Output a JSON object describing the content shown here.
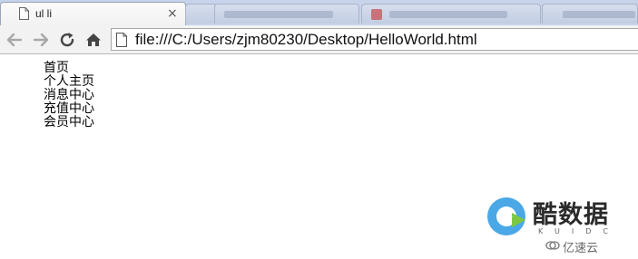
{
  "browser": {
    "active_tab": {
      "title": "ul li",
      "close_glyph": "×",
      "icon": "page-icon"
    },
    "toolbar": {
      "back_icon": "back-arrow-icon",
      "forward_icon": "forward-arrow-icon",
      "reload_icon": "reload-icon",
      "home_icon": "home-icon"
    },
    "address": {
      "url": "file:///C:/Users/zjm80230/Desktop/HelloWorld.html",
      "icon": "page-icon"
    }
  },
  "page": {
    "list_items": [
      "首页",
      "个人主页",
      "消息中心",
      "充值中心",
      "会员中心"
    ]
  },
  "watermark": {
    "brand": "酷数据",
    "sub": "KUIDC",
    "secondary": "亿速云"
  },
  "colors": {
    "tabstrip": "#c7d3ea",
    "toolbar": "#f2f2f2",
    "logo_blue": "#4aa8e6",
    "logo_green": "#7cc843"
  }
}
